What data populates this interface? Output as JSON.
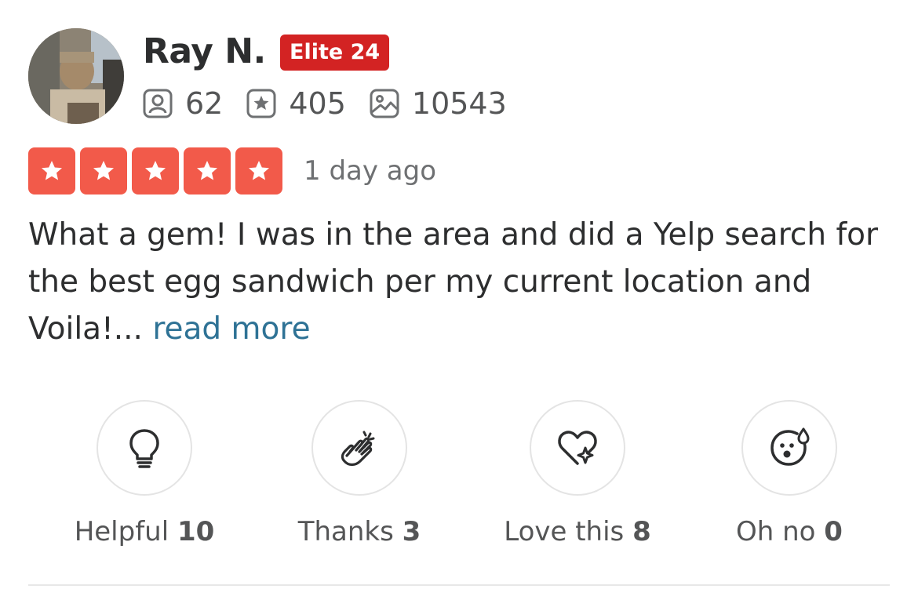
{
  "user": {
    "name": "Ray N.",
    "elite_badge": "Elite 24",
    "stats": {
      "friends": "62",
      "reviews": "405",
      "photos": "10543"
    }
  },
  "review": {
    "rating": 5,
    "date": "1 day ago",
    "text": "What a gem! I was in the area and did a Yelp search for the best egg sandwich per my current location and Voila!...",
    "read_more": "read more"
  },
  "reactions": [
    {
      "label": "Helpful",
      "count": "10",
      "icon": "lightbulb-icon"
    },
    {
      "label": "Thanks",
      "count": "3",
      "icon": "clapping-hands-icon"
    },
    {
      "label": "Love this",
      "count": "8",
      "icon": "heart-sparkle-icon"
    },
    {
      "label": "Oh no",
      "count": "0",
      "icon": "surprised-face-icon"
    }
  ],
  "colors": {
    "brand_red": "#d32323",
    "star_red": "#f25a4a",
    "link_blue": "#2e7295"
  }
}
